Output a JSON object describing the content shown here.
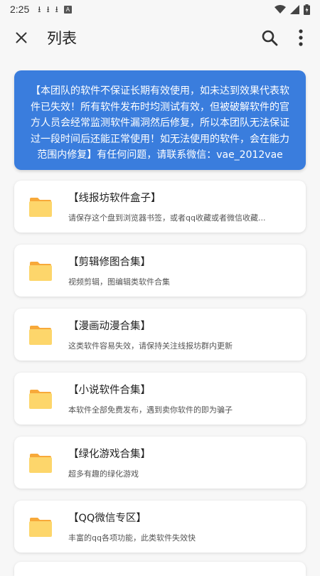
{
  "status": {
    "time": "2:25"
  },
  "appbar": {
    "title": "列表"
  },
  "notice": {
    "text": "【本团队的软件不保证长期有效使用，如未达到效果代表软件已失效！所有软件发布时均测试有效，但被破解软件的官方人员会经常监测软件漏洞然后修复，所以本团队无法保证过一段时间后还能正常使用！如无法使用的软件，会在能力范围内修复】有任何问题，请联系微信：vae_2012vae"
  },
  "items": [
    {
      "title": "【线报坊软件盒子】",
      "subtitle": "请保存这个盘到浏览器书签，或者qq收藏或者微信收藏..."
    },
    {
      "title": "【剪辑修图合集】",
      "subtitle": "视频剪辑，图编辑类软件合集"
    },
    {
      "title": "【漫画动漫合集】",
      "subtitle": "这类软件容易失效，请保持关注线报坊群内更新"
    },
    {
      "title": "【小说软件合集】",
      "subtitle": "本软件全部免费发布，遇到卖你软件的即为骗子"
    },
    {
      "title": "【绿化游戏合集】",
      "subtitle": "超多有趣的绿化游戏"
    },
    {
      "title": "【QQ微信专区】",
      "subtitle": "丰富的qq各项功能，此类软件失效快"
    }
  ],
  "colors": {
    "accent": "#3a7ddd",
    "folder": "#fdd66b",
    "folder_tab": "#f7a93a"
  },
  "icons": {
    "close": "close-icon",
    "search": "search-icon",
    "more": "more-vert-icon",
    "folder": "folder-icon"
  }
}
